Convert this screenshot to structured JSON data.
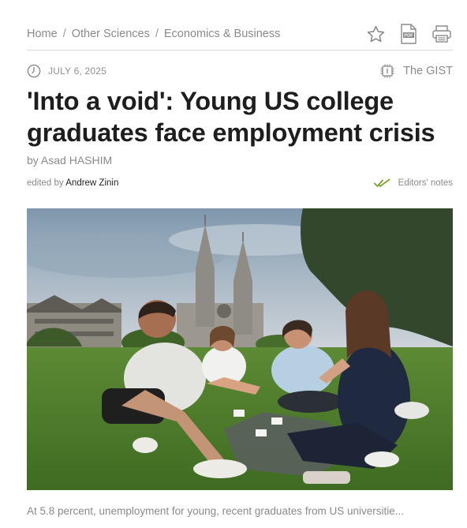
{
  "breadcrumb": {
    "items": [
      "Home",
      "Other Sciences",
      "Economics & Business"
    ],
    "separator": "/"
  },
  "toolbar": {
    "icons": [
      "star-icon",
      "pdf-icon",
      "print-icon"
    ],
    "pdf_text": "PDF"
  },
  "meta": {
    "date": "JULY 6, 2025",
    "gist_label": "The GIST"
  },
  "article": {
    "title": "'Into a void': Young US college graduates face employment crisis",
    "byline": "by Asad HASHIM",
    "edited_prefix": "edited by",
    "editor": "Andrew Zinin",
    "editors_notes": "Editors' notes",
    "caption": "At 5.8 percent, unemployment for young, recent graduates from US universitie..."
  },
  "colors": {
    "check_green": "#7aa22c",
    "muted_text": "#8a8a8a",
    "title_text": "#1e1e1e"
  }
}
